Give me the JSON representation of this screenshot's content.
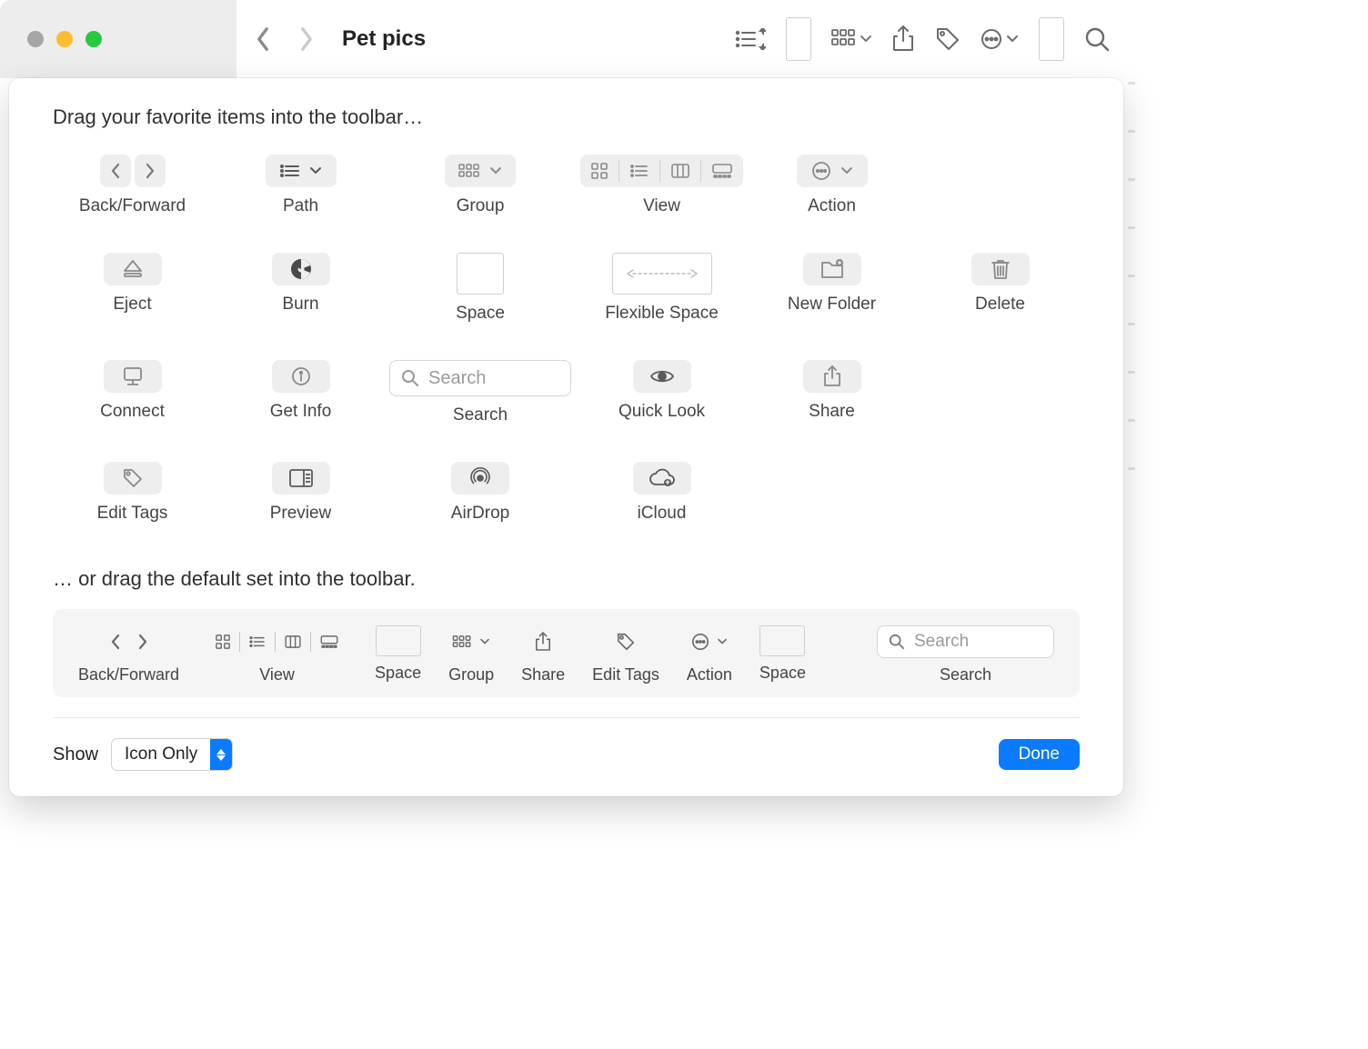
{
  "window": {
    "title": "Pet pics"
  },
  "sheet": {
    "heading": "Drag your favorite items into the toolbar…",
    "default_heading": "… or drag the default set into the toolbar."
  },
  "palette": {
    "back_forward": "Back/Forward",
    "path": "Path",
    "group": "Group",
    "view": "View",
    "action": "Action",
    "eject": "Eject",
    "burn": "Burn",
    "space": "Space",
    "flexible_space": "Flexible Space",
    "new_folder": "New Folder",
    "delete": "Delete",
    "connect": "Connect",
    "get_info": "Get Info",
    "search": "Search",
    "search_placeholder": "Search",
    "quick_look": "Quick Look",
    "share": "Share",
    "edit_tags": "Edit Tags",
    "preview": "Preview",
    "airdrop": "AirDrop",
    "icloud": "iCloud"
  },
  "default_set": {
    "back_forward": "Back/Forward",
    "view": "View",
    "space1": "Space",
    "group": "Group",
    "share": "Share",
    "edit_tags": "Edit Tags",
    "action": "Action",
    "space2": "Space",
    "search": "Search",
    "search_placeholder": "Search"
  },
  "bottom": {
    "show_label": "Show",
    "show_value": "Icon Only",
    "done": "Done"
  }
}
